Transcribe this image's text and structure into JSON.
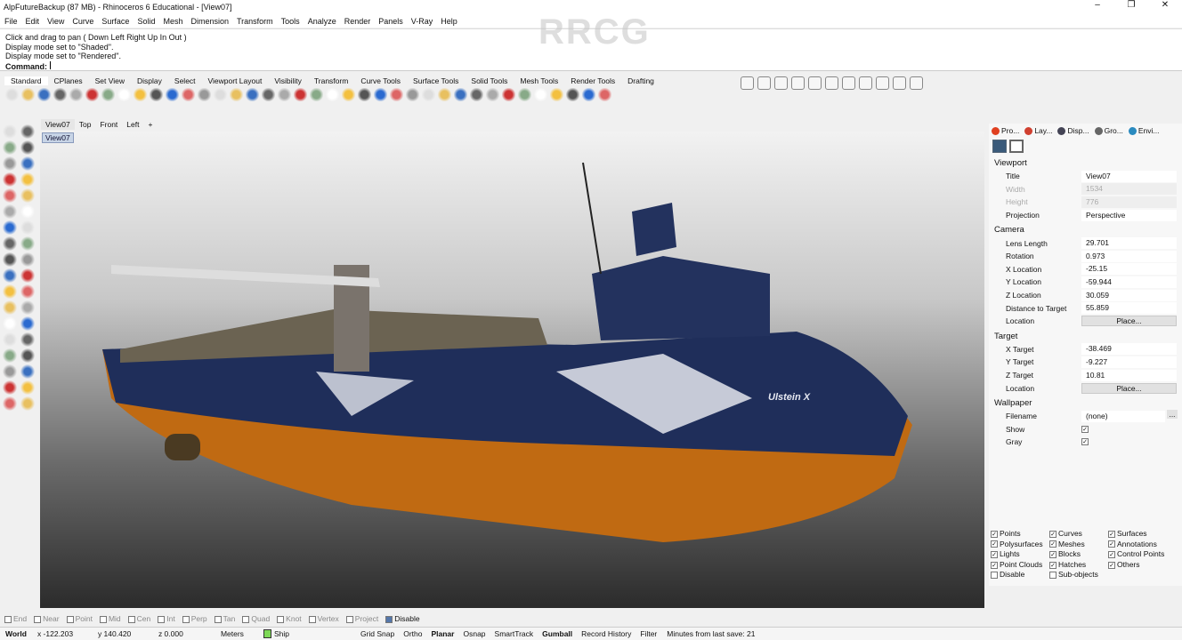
{
  "title": "AlpFutureBackup (87 MB) - Rhinoceros 6 Educational - [View07]",
  "window_controls": [
    "–",
    "❐",
    "✕"
  ],
  "menu": [
    "File",
    "Edit",
    "View",
    "Curve",
    "Surface",
    "Solid",
    "Mesh",
    "Dimension",
    "Transform",
    "Tools",
    "Analyze",
    "Render",
    "Panels",
    "V-Ray",
    "Help"
  ],
  "command_history": [
    "Click and drag to pan ( Down  Left  Right  Up  In  Out )",
    "Display mode set to \"Shaded\".",
    "Display mode set to \"Rendered\"."
  ],
  "command_label": "Command:",
  "toolbar_tabs": [
    "Standard",
    "CPlanes",
    "Set View",
    "Display",
    "Select",
    "Viewport Layout",
    "Visibility",
    "Transform",
    "Curve Tools",
    "Surface Tools",
    "Solid Tools",
    "Mesh Tools",
    "Render Tools",
    "Drafting"
  ],
  "viewport_tabs": [
    "View07",
    "Top",
    "Front",
    "Left",
    "+"
  ],
  "viewport_label": "View07",
  "ship_name": "Ulstein X",
  "watermark": "RRCG",
  "panel": {
    "tabs": [
      "Pro...",
      "Lay...",
      "Disp...",
      "Gro...",
      "Envi..."
    ],
    "viewport_section": "Viewport",
    "viewport": [
      {
        "k": "Title",
        "v": "View07"
      },
      {
        "k": "Width",
        "v": "1534",
        "dis": true
      },
      {
        "k": "Height",
        "v": "776",
        "dis": true
      },
      {
        "k": "Projection",
        "v": "Perspective"
      }
    ],
    "camera_section": "Camera",
    "camera": [
      {
        "k": "Lens Length",
        "v": "29.701"
      },
      {
        "k": "Rotation",
        "v": "0.973"
      },
      {
        "k": "X Location",
        "v": "-25.15"
      },
      {
        "k": "Y Location",
        "v": "-59.944"
      },
      {
        "k": "Z Location",
        "v": "30.059"
      },
      {
        "k": "Distance to Target",
        "v": "55.859"
      }
    ],
    "location_label": "Location",
    "place_label": "Place...",
    "target_section": "Target",
    "target": [
      {
        "k": "X Target",
        "v": "-38.469"
      },
      {
        "k": "Y Target",
        "v": "-9.227"
      },
      {
        "k": "Z Target",
        "v": "10.81"
      }
    ],
    "wallpaper_section": "Wallpaper",
    "filename_label": "Filename",
    "filename_value": "(none)",
    "browse_label": "...",
    "show_label": "Show",
    "gray_label": "Gray"
  },
  "filters": [
    {
      "l": "Points",
      "c": true
    },
    {
      "l": "Curves",
      "c": true
    },
    {
      "l": "Surfaces",
      "c": true
    },
    {
      "l": "Polysurfaces",
      "c": true
    },
    {
      "l": "Meshes",
      "c": true
    },
    {
      "l": "Annotations",
      "c": true
    },
    {
      "l": "Lights",
      "c": true
    },
    {
      "l": "Blocks",
      "c": true
    },
    {
      "l": "Control Points",
      "c": true
    },
    {
      "l": "Point Clouds",
      "c": true
    },
    {
      "l": "Hatches",
      "c": true
    },
    {
      "l": "Others",
      "c": true
    },
    {
      "l": "Disable",
      "c": false
    },
    {
      "l": "Sub-objects",
      "c": false
    }
  ],
  "osnap": [
    {
      "l": "End",
      "c": false
    },
    {
      "l": "Near",
      "c": false
    },
    {
      "l": "Point",
      "c": false
    },
    {
      "l": "Mid",
      "c": false
    },
    {
      "l": "Cen",
      "c": false
    },
    {
      "l": "Int",
      "c": false
    },
    {
      "l": "Perp",
      "c": false
    },
    {
      "l": "Tan",
      "c": false
    },
    {
      "l": "Quad",
      "c": false
    },
    {
      "l": "Knot",
      "c": false
    },
    {
      "l": "Vertex",
      "c": false
    },
    {
      "l": "Project",
      "c": false
    },
    {
      "l": "Disable",
      "c": true
    }
  ],
  "status": {
    "cplane": "World",
    "x": "x -122.203",
    "y": "y 140.420",
    "z": "z 0.000",
    "units": "Meters",
    "layer": "Ship",
    "layer_color": "#7ed957",
    "toggles": [
      "Grid Snap",
      "Ortho",
      "Planar",
      "Osnap",
      "SmartTrack",
      "Gumball",
      "Record History",
      "Filter"
    ],
    "bold_toggles": [
      "Planar",
      "Gumball"
    ],
    "autosave": "Minutes from last save: 21"
  }
}
